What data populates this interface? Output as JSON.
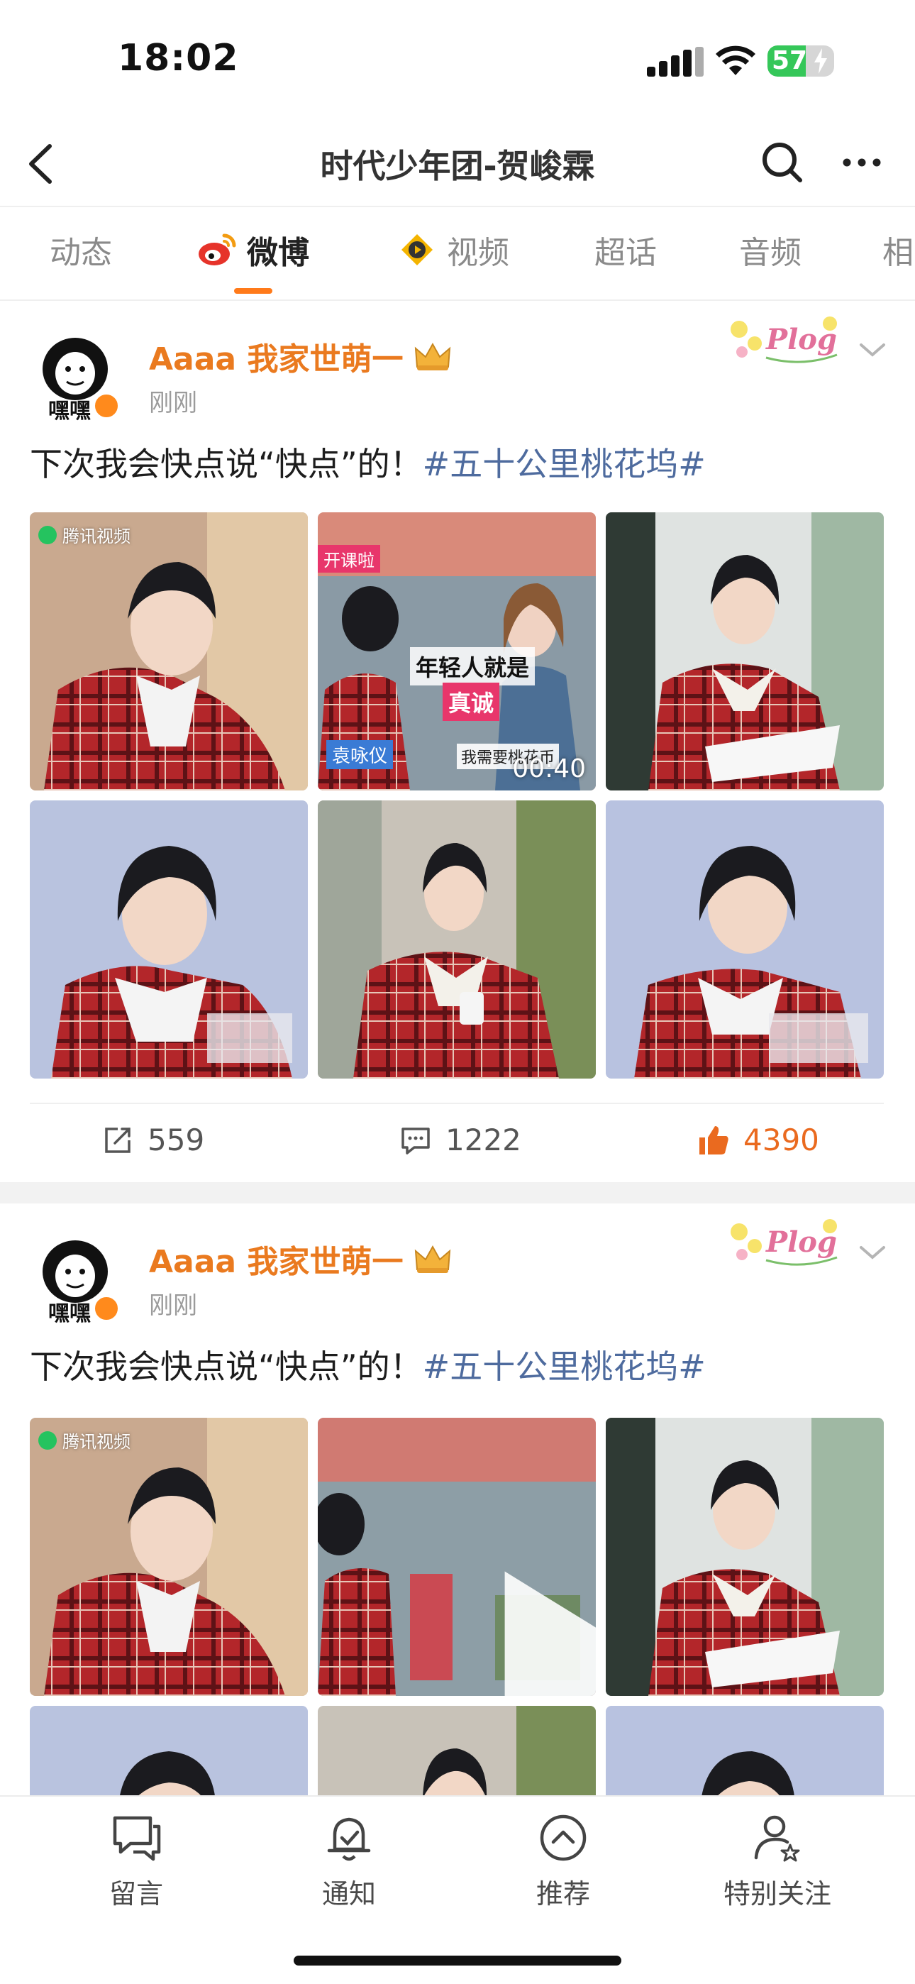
{
  "status_bar": {
    "time": "18:02",
    "battery_percent": "57",
    "battery_level": 0.57,
    "icons": [
      "cellular-signal-icon",
      "wifi-icon",
      "battery-icon",
      "charging-bolt-icon"
    ]
  },
  "nav": {
    "title": "时代少年团-贺峻霖",
    "icons": [
      "back-arrow-icon",
      "search-icon",
      "more-icon"
    ]
  },
  "tabs": [
    {
      "label": "动态",
      "active": false
    },
    {
      "label": "微博",
      "active": true,
      "icon": "weibo-icon"
    },
    {
      "label": "视频",
      "active": false,
      "icon": "video-icon"
    },
    {
      "label": "超话",
      "active": false
    },
    {
      "label": "音频",
      "active": false
    },
    {
      "label": "相",
      "active": false
    }
  ],
  "posts": [
    {
      "username": "Aaaa 我家世萌一",
      "avatar_caption": "嘿嘿",
      "time": "刚刚",
      "text": "下次我会快点说“快点”的！",
      "topic": "#五十公里桃花坞#",
      "thumb_badge": "腾讯视频",
      "video_overlay": {
        "tag": "开课啦",
        "line1": "年轻人就是",
        "line2": "真诚",
        "name": "袁咏仪",
        "subtitle": "我需要桃花币",
        "duration": "00:40"
      },
      "actions": {
        "reposts": "559",
        "comments": "1222",
        "likes": "4390"
      }
    },
    {
      "username": "Aaaa 我家世萌一",
      "avatar_caption": "嘿嘿",
      "time": "刚刚",
      "text": "下次我会快点说“快点”的！",
      "topic": "#五十公里桃花坞#",
      "thumb_badge": "腾讯视频"
    }
  ],
  "bottom_bar": [
    {
      "label": "留言",
      "icon": "message-icon"
    },
    {
      "label": "通知",
      "icon": "bell-icon"
    },
    {
      "label": "推荐",
      "icon": "recommend-up-icon"
    },
    {
      "label": "特别关注",
      "icon": "special-follow-icon"
    }
  ],
  "colors": {
    "accent": "#ea7a1f",
    "topic": "#4e6b9e",
    "like": "#ea6a1f",
    "tab_underline": "#ff7a1a",
    "battery": "#35c759"
  }
}
